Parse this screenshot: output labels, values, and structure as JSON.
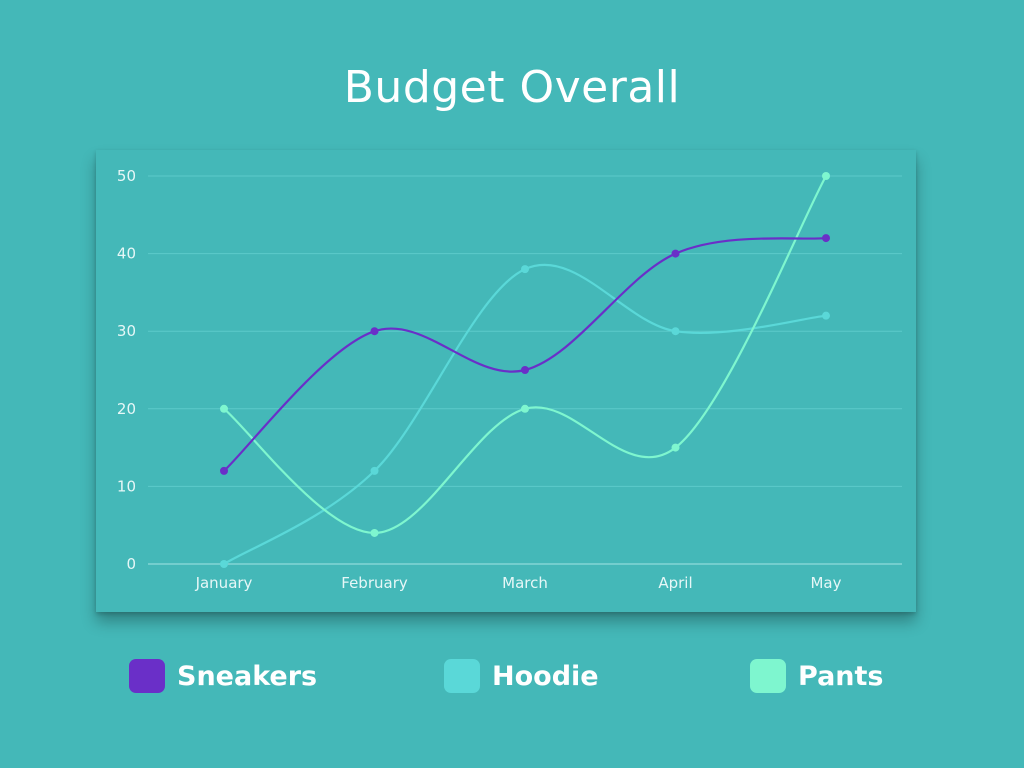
{
  "colors": {
    "background": "#44b8b8",
    "grid": "#5ccaca",
    "axis": "#8fdcdc"
  },
  "chart_data": {
    "type": "line",
    "title": "Budget Overall",
    "categories": [
      "January",
      "February",
      "March",
      "April",
      "May"
    ],
    "ylim": [
      0,
      50
    ],
    "yticks": [
      0,
      10,
      20,
      30,
      40,
      50
    ],
    "grid": true,
    "smooth": true,
    "legend_position": "bottom",
    "series": [
      {
        "name": "Sneakers",
        "color": "#6a2fc8",
        "values": [
          12,
          30,
          25,
          40,
          42
        ]
      },
      {
        "name": "Hoodie",
        "color": "#5ad8d8",
        "values": [
          0,
          12,
          38,
          30,
          32
        ]
      },
      {
        "name": "Pants",
        "color": "#7ef6cf",
        "values": [
          20,
          4,
          20,
          15,
          50
        ]
      }
    ]
  }
}
